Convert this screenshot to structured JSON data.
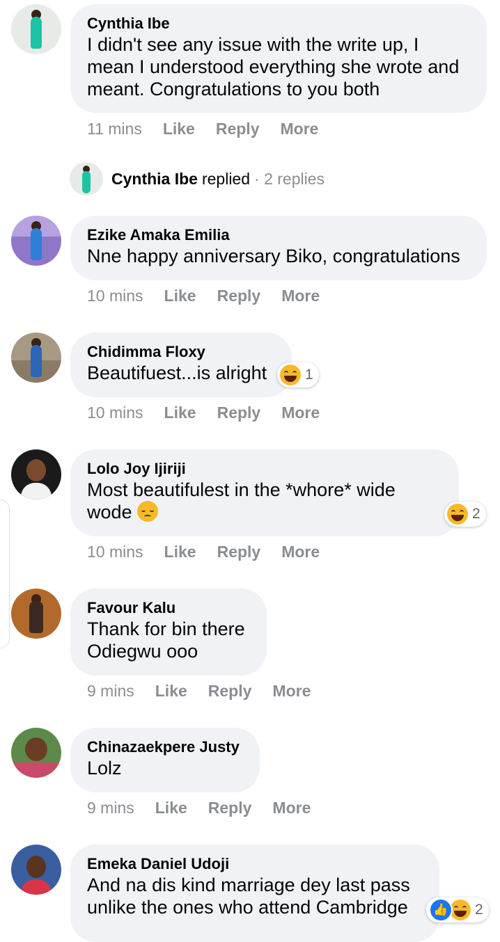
{
  "comments": [
    {
      "name": "Cynthia Ibe",
      "lines": [
        "I didn't see any issue with the write up, I",
        "mean I understood everything she wrote and",
        "meant. Congratulations to you both"
      ],
      "time": "11 mins",
      "like": "Like",
      "reply": "Reply",
      "more": "More"
    },
    {
      "name": "Ezike Amaka Emilia",
      "lines": [
        "Nne happy anniversary Biko, congratulations"
      ],
      "time": "10 mins",
      "like": "Like",
      "reply": "Reply",
      "more": "More"
    },
    {
      "name": "Chidimma Floxy",
      "lines": [
        "Beautifuest...is alright"
      ],
      "time": "10 mins",
      "like": "Like",
      "reply": "Reply",
      "more": "More",
      "reaction_count": "1"
    },
    {
      "name": "Lolo Joy Ijiriji",
      "lines": [
        "Most beautifulest in the *whore* wide",
        "wode"
      ],
      "time": "10 mins",
      "like": "Like",
      "reply": "Reply",
      "more": "More",
      "reaction_count": "2"
    },
    {
      "name": "Favour Kalu",
      "lines": [
        "Thank for bin there",
        "Odiegwu ooo"
      ],
      "time": "9 mins",
      "like": "Like",
      "reply": "Reply",
      "more": "More"
    },
    {
      "name": "Chinazaekpere Justy",
      "lines": [
        "Lolz"
      ],
      "time": "9 mins",
      "like": "Like",
      "reply": "Reply",
      "more": "More"
    },
    {
      "name": "Emeka Daniel Udoji",
      "lines": [
        "And na dis kind marriage dey last pass",
        "unlike the ones who attend Cambridge"
      ],
      "reaction_count": "2"
    }
  ],
  "reply_summary": {
    "name": "Cynthia Ibe",
    "verb": "replied",
    "count": "· 2 replies"
  },
  "colors": {
    "bubble": "#f0f2f5",
    "meta": "#8a8d91",
    "like_blue": "#1877f2",
    "emoji_yellow": "#f7b928"
  },
  "icons": {
    "haha": "haha-reaction-icon",
    "like": "like-reaction-icon",
    "sad": "pensive-emoji-icon"
  }
}
